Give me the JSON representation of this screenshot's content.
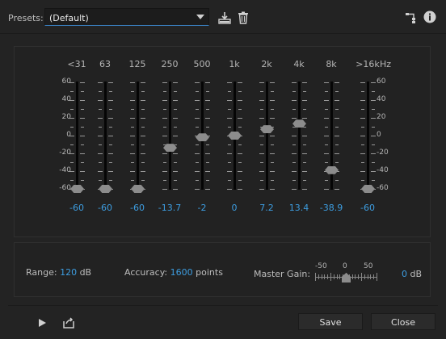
{
  "presets": {
    "label": "Presets:",
    "selected": "(Default)"
  },
  "eq": {
    "bands": [
      {
        "label": "<31",
        "gain_db": -60,
        "value_text": "-60"
      },
      {
        "label": "63",
        "gain_db": -60,
        "value_text": "-60"
      },
      {
        "label": "125",
        "gain_db": -60,
        "value_text": "-60"
      },
      {
        "label": "250",
        "gain_db": -13.7,
        "value_text": "-13.7"
      },
      {
        "label": "500",
        "gain_db": -2,
        "value_text": "-2"
      },
      {
        "label": "1k",
        "gain_db": 0,
        "value_text": "0"
      },
      {
        "label": "2k",
        "gain_db": 7.2,
        "value_text": "7.2"
      },
      {
        "label": "4k",
        "gain_db": 13.4,
        "value_text": "13.4"
      },
      {
        "label": "8k",
        "gain_db": -38.9,
        "value_text": "-38.9"
      },
      {
        "label": ">16k",
        "gain_db": -60,
        "value_text": "-60"
      }
    ],
    "unit_label": "Hz",
    "scale": [
      "60",
      "40",
      "20",
      "0",
      "-20",
      "-40",
      "-60"
    ],
    "range_db": [
      -60,
      60
    ]
  },
  "settings": {
    "range_label": "Range:",
    "range_value": "120",
    "range_unit": "dB",
    "accuracy_label": "Accuracy:",
    "accuracy_value": "1600",
    "accuracy_unit": "points",
    "master_gain_label": "Master Gain:",
    "master_gain_scale": [
      "-50",
      "0",
      "50"
    ],
    "master_gain_value": "0",
    "master_gain_unit": "dB",
    "master_gain_db": 0
  },
  "buttons": {
    "save": "Save",
    "close": "Close"
  },
  "colors": {
    "accent": "#3d9de0",
    "background": "#232323"
  },
  "icons": [
    "save-preset-icon",
    "delete-preset-icon",
    "routing-icon",
    "info-icon",
    "play-icon",
    "export-icon"
  ]
}
